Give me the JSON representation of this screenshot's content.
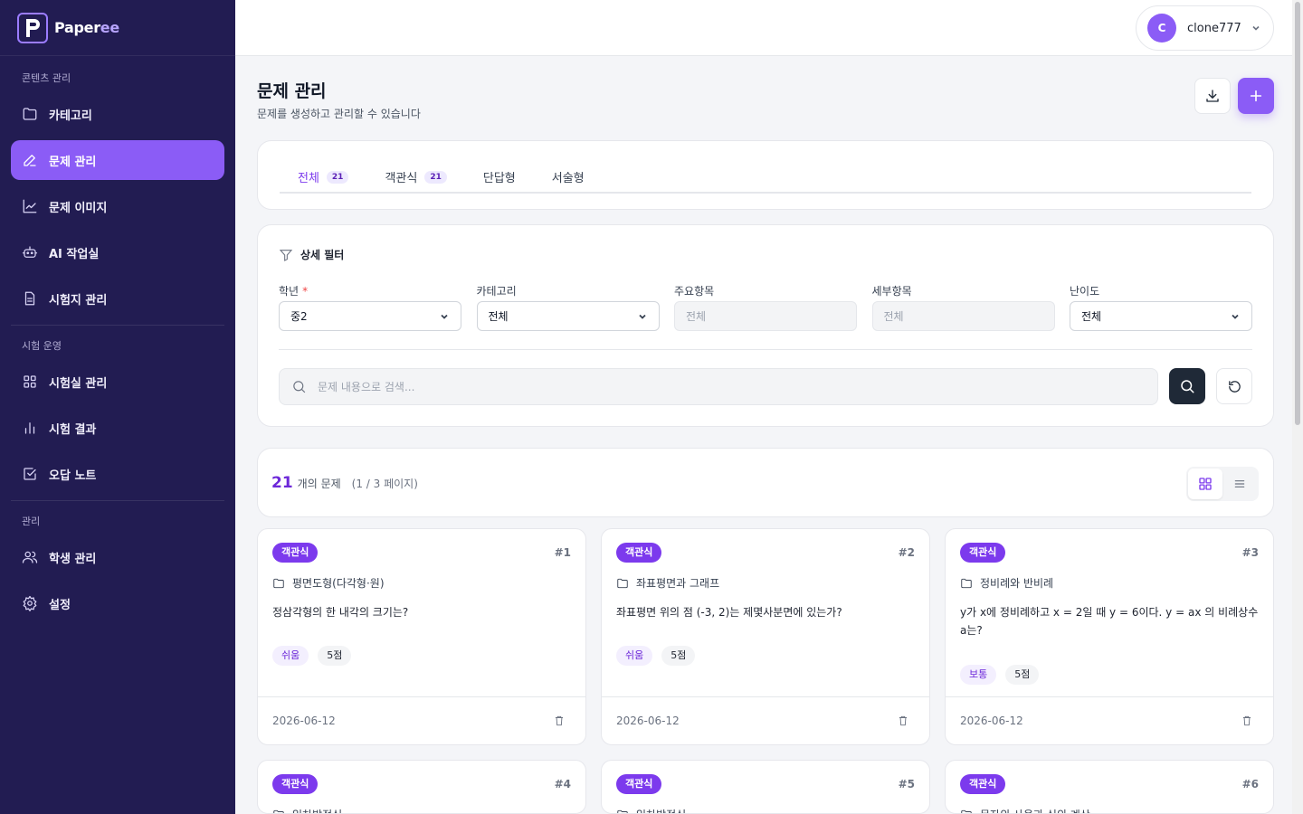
{
  "app": {
    "logo_main": "Paper",
    "logo_accent": "ee"
  },
  "sidebar": {
    "sections": [
      {
        "title": "콘텐츠 관리"
      },
      {
        "title": "시험 운영"
      },
      {
        "title": "관리"
      }
    ],
    "items": [
      {
        "label": "카테고리",
        "icon": "folder-icon"
      },
      {
        "label": "문제 관리",
        "icon": "pencil-icon",
        "active": true
      },
      {
        "label": "문제 이미지",
        "icon": "chart-line-icon"
      },
      {
        "label": "AI 작업실",
        "icon": "robot-icon"
      },
      {
        "label": "시험지 관리",
        "icon": "document-icon"
      },
      {
        "label": "시험실 관리",
        "icon": "grid-icon"
      },
      {
        "label": "시험 결과",
        "icon": "bar-chart-icon"
      },
      {
        "label": "오답 노트",
        "icon": "checkbox-icon"
      },
      {
        "label": "학생 관리",
        "icon": "users-icon"
      },
      {
        "label": "설정",
        "icon": "gear-icon"
      }
    ]
  },
  "topbar": {
    "user_initial": "C",
    "username": "clone777"
  },
  "page": {
    "title": "문제 관리",
    "subtitle": "문제를 생성하고 관리할 수 있습니다"
  },
  "tabs": [
    {
      "label": "전체",
      "count": "21",
      "active": true
    },
    {
      "label": "객관식",
      "count": "21"
    },
    {
      "label": "단답형"
    },
    {
      "label": "서술형"
    }
  ],
  "filter": {
    "title": "상세 필터",
    "fields": [
      {
        "label": "학년",
        "required": true,
        "value": "중2",
        "disabled": false
      },
      {
        "label": "카테고리",
        "value": "전체",
        "disabled": false
      },
      {
        "label": "주요항목",
        "value": "전체",
        "disabled": true
      },
      {
        "label": "세부항목",
        "value": "전체",
        "disabled": true
      },
      {
        "label": "난이도",
        "value": "전체",
        "disabled": false
      }
    ],
    "required_mark": "*",
    "search_placeholder": "문제 내용으로 검색..."
  },
  "results": {
    "count": "21",
    "count_label": "개의 문제",
    "page_info": "(1 / 3 페이지)",
    "view_mode": "grid"
  },
  "questions": [
    {
      "type": "객관식",
      "number": "#1",
      "category": "평면도형(다각형·원)",
      "text": "정삼각형의 한 내각의 크기는?",
      "level": "쉬움",
      "points": "5점",
      "date": "2026-06-12"
    },
    {
      "type": "객관식",
      "number": "#2",
      "category": "좌표평면과 그래프",
      "text": "좌표평면 위의 점 (-3, 2)는 제몇사분면에 있는가?",
      "level": "쉬움",
      "points": "5점",
      "date": "2026-06-12"
    },
    {
      "type": "객관식",
      "number": "#3",
      "category": "정비례와 반비례",
      "text": "y가 x에 정비례하고 x = 2일 때 y = 6이다. y = ax 의 비례상수 a는?",
      "level": "보통",
      "points": "5점",
      "date": "2026-06-12"
    },
    {
      "type": "객관식",
      "number": "#4",
      "category": "일차방정식"
    },
    {
      "type": "객관식",
      "number": "#5",
      "category": "일차방정식"
    },
    {
      "type": "객관식",
      "number": "#6",
      "category": "문자의 사용과 식의 계산"
    }
  ],
  "colors": {
    "sidebar_bg": "#221c52",
    "accent": "#8b5cf6",
    "badge_bg": "#7c3aed"
  }
}
